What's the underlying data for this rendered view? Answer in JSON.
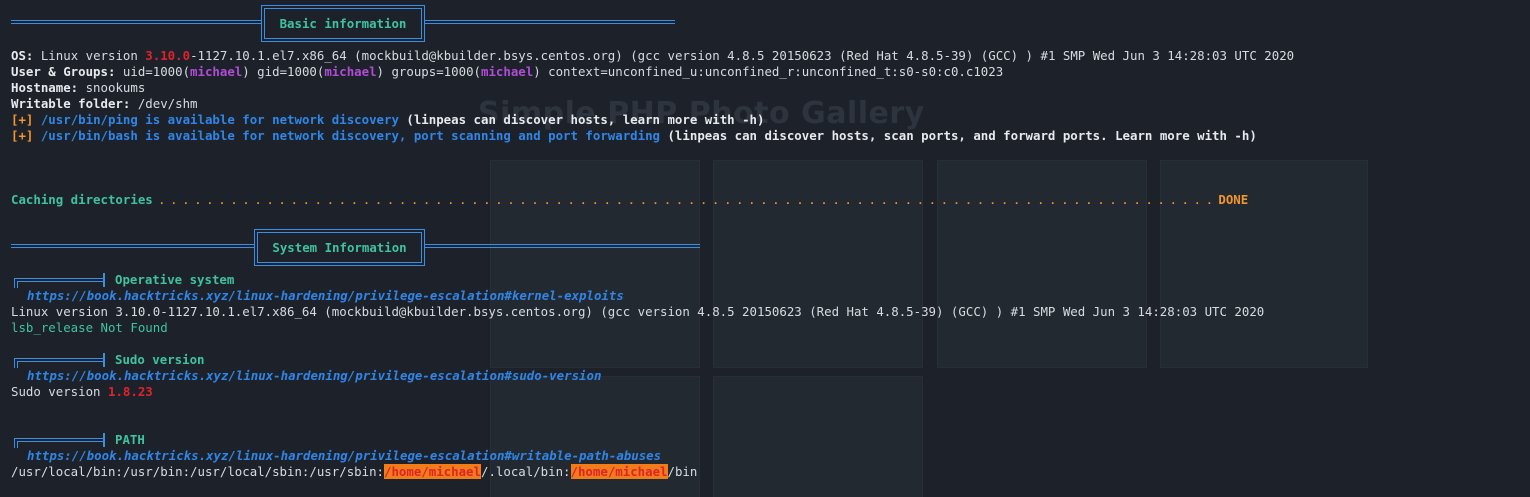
{
  "colors": {
    "background": "#1d222a",
    "text": "#d7dbe0",
    "red": "#e0232a",
    "purple": "#b04cd6",
    "orange": "#f0962a",
    "blue": "#2f86e8",
    "teal": "#3ec2a2",
    "highlight": "#f07c1a"
  },
  "sections": {
    "basic": "Basic information",
    "system": "System Information"
  },
  "basic": {
    "os_label": "OS:",
    "os_pre": " Linux version ",
    "os_ver": "3.10.0",
    "os_post": "-1127.10.1.el7.x86_64 (mockbuild@kbuilder.bsys.centos.org) (gcc version 4.8.5 20150623 (Red Hat 4.8.5-39) (GCC) ) #1 SMP Wed Jun 3 14:28:03 UTC 2020",
    "ug_label": "User & Groups:",
    "ug_1": " uid=1000(",
    "ug_user1": "michael",
    "ug_2": ") gid=1000(",
    "ug_user2": "michael",
    "ug_3": ") groups=1000(",
    "ug_user3": "michael",
    "ug_4": ") context=unconfined_u:unconfined_r:unconfined_t:s0-s0:c0.c1023",
    "host_label": "Hostname:",
    "host_value": " snookums",
    "wf_label": "Writable folder:",
    "wf_value": " /dev/shm",
    "ping_tag": "[+]",
    "ping_blue": " /usr/bin/ping is available for network discovery",
    "ping_white": " (linpeas can discover hosts, learn more with -h)",
    "bash_tag": "[+]",
    "bash_blue": " /usr/bin/bash is available for network discovery, port scanning and port forwarding",
    "bash_white": " (linpeas can discover hosts, scan ports, and forward ports. Learn more with -h)"
  },
  "caching": {
    "label": "Caching directories",
    "dots": " . . . . . . . . . . . . . . . . . . . . . . . . . . . . . . . . . . . . . . . . . . . . . . . . . . . . . . . . . . . . . . . . . . . . . . . . . . . . . . . . . . . . . . . . ",
    "done": "DONE"
  },
  "operative": {
    "title": "Operative system",
    "link": "https://book.hacktricks.xyz/linux-hardening/privilege-escalation#kernel-exploits",
    "line1": "Linux version 3.10.0-1127.10.1.el7.x86_64 (mockbuild@kbuilder.bsys.centos.org) (gcc version 4.8.5 20150623 (Red Hat 4.8.5-39) (GCC) ) #1 SMP Wed Jun 3 14:28:03 UTC 2020",
    "line2": "lsb_release Not Found"
  },
  "sudo": {
    "title": "Sudo version",
    "link": "https://book.hacktricks.xyz/linux-hardening/privilege-escalation#sudo-version",
    "prefix": "Sudo version ",
    "version": "1.8.23"
  },
  "path": {
    "title": "PATH",
    "link": "https://book.hacktricks.xyz/linux-hardening/privilege-escalation#writable-path-abuses",
    "p1": "/usr/local/bin:/usr/bin:/usr/local/sbin:/usr/sbin:",
    "p2": "/home/michael",
    "p3": "/.local/bin:",
    "p4": "/home/michael",
    "p5": "/bin"
  }
}
